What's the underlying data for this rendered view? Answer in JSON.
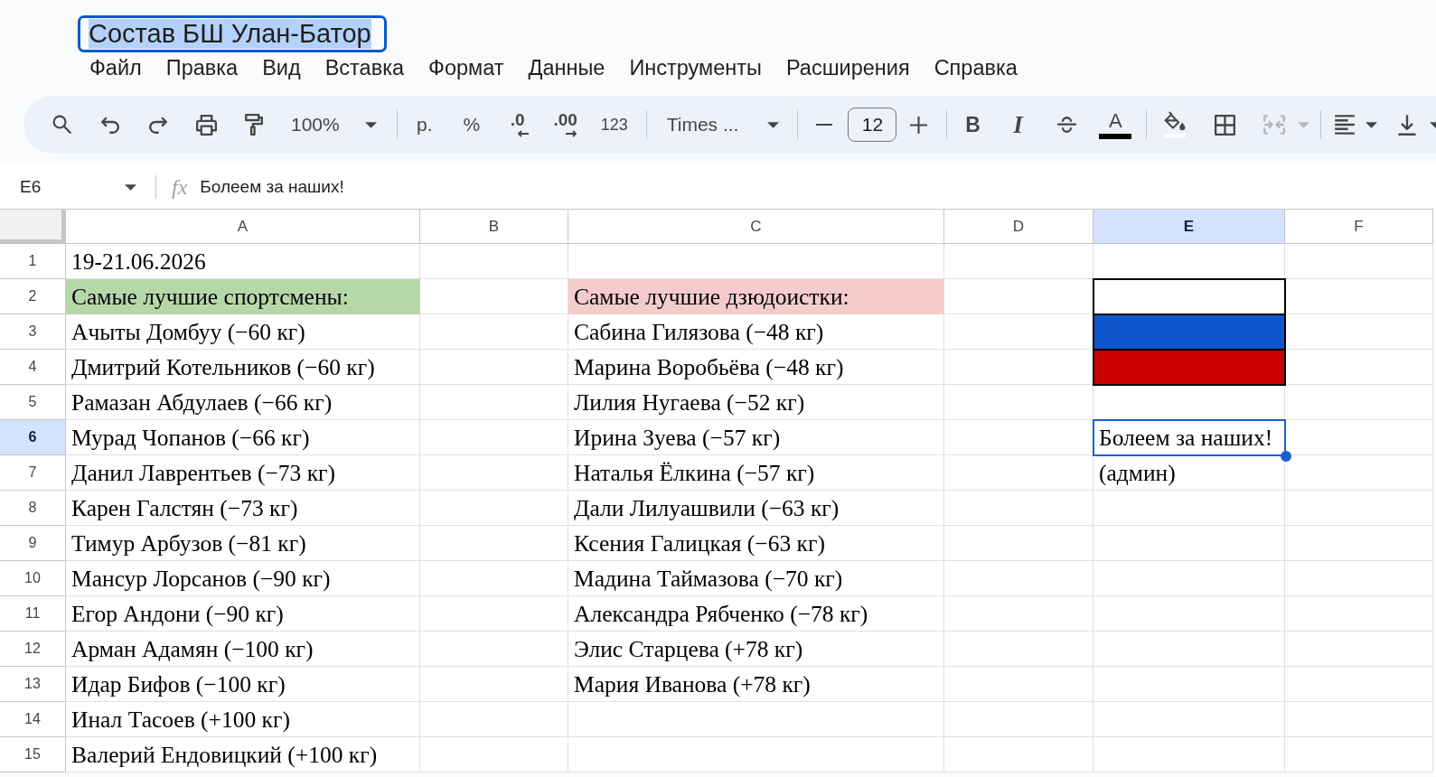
{
  "document": {
    "title": "Состав БШ Улан-Батор",
    "focused": true
  },
  "menu": [
    "Файл",
    "Правка",
    "Вид",
    "Вставка",
    "Формат",
    "Данные",
    "Инструменты",
    "Расширения",
    "Справка"
  ],
  "toolbar": {
    "zoom": "100%",
    "currency": "р.",
    "percent": "%",
    "decimal_decrease": ".0",
    "decimal_increase": ".00",
    "number_format": "123",
    "font": "Times ...",
    "font_size": "12",
    "bold": "B",
    "italic": "I",
    "text_color": "A",
    "merge_disabled": true
  },
  "formula_bar": {
    "cell_reference": "E6",
    "function_label": "fx",
    "value": "Болеем за наших!"
  },
  "grid": {
    "columns": [
      {
        "label": "A",
        "selected": false
      },
      {
        "label": "B",
        "selected": false
      },
      {
        "label": "C",
        "selected": false
      },
      {
        "label": "D",
        "selected": false
      },
      {
        "label": "E",
        "selected": true
      },
      {
        "label": "F",
        "selected": false
      }
    ],
    "rows": [
      {
        "label": "1",
        "selected": false,
        "a": {
          "text": "19-21.06.2026"
        }
      },
      {
        "label": "2",
        "selected": false,
        "a": {
          "text": "Самые лучшие спортсмены:",
          "color": "#b6d7a8",
          "bordered": false
        },
        "c": {
          "text": "Самые лучшие дзюдоистки:",
          "color": "#f4cccc",
          "bordered": false
        },
        "e": {
          "color": "#ffffff",
          "bordered": true
        }
      },
      {
        "label": "3",
        "selected": false,
        "a": {
          "text": "Ачыты Домбуу (−60 кг)"
        },
        "c": {
          "text": "Сабина Гилязова (−48 кг)"
        },
        "e": {
          "color": "#1155cc",
          "bordered": true
        }
      },
      {
        "label": "4",
        "selected": false,
        "a": {
          "text": "Дмитрий Котельников (−60 кг)"
        },
        "c": {
          "text": "Марина Воробьёва (−48 кг)"
        },
        "e": {
          "color": "#cc0000",
          "bordered": true
        }
      },
      {
        "label": "5",
        "selected": false,
        "a": {
          "text": "Рамазан Абдулаев (−66 кг)"
        },
        "c": {
          "text": "Лилия Нугаева (−52 кг)"
        }
      },
      {
        "label": "6",
        "selected": true,
        "a": {
          "text": "Мурад Чопанов (−66 кг)"
        },
        "c": {
          "text": "Ирина Зуева (−57 кг)"
        },
        "e": {
          "text": "Болеем за наших!"
        }
      },
      {
        "label": "7",
        "selected": false,
        "a": {
          "text": "Данил Лаврентьев (−73 кг)"
        },
        "c": {
          "text": "Наталья Ёлкина (−57 кг)"
        },
        "e": {
          "text": "(админ)"
        }
      },
      {
        "label": "8",
        "selected": false,
        "a": {
          "text": "Карен Галстян (−73 кг)"
        },
        "c": {
          "text": "Дали Лилуашвили (−63 кг)"
        }
      },
      {
        "label": "9",
        "selected": false,
        "a": {
          "text": "Тимур Арбузов (−81 кг)"
        },
        "c": {
          "text": "Ксения Галицкая (−63 кг)"
        }
      },
      {
        "label": "10",
        "selected": false,
        "a": {
          "text": "Мансур Лорсанов (−90 кг)"
        },
        "c": {
          "text": "Мадина Таймазова (−70 кг)"
        }
      },
      {
        "label": "11",
        "selected": false,
        "a": {
          "text": "Егор Андони (−90 кг)"
        },
        "c": {
          "text": "Александра Рябченко (−78 кг)"
        }
      },
      {
        "label": "12",
        "selected": false,
        "a": {
          "text": "Арман Адамян (−100 кг)"
        },
        "c": {
          "text": "Элис Старцева (+78 кг)"
        }
      },
      {
        "label": "13",
        "selected": false,
        "a": {
          "text": "Идар Бифов (−100 кг)"
        },
        "c": {
          "text": "Мария Иванова (+78 кг)"
        }
      },
      {
        "label": "14",
        "selected": false,
        "a": {
          "text": "Инал Тасоев (+100 кг)"
        }
      },
      {
        "label": "15",
        "selected": false,
        "a": {
          "text": "Валерий Ендовицкий (+100 кг)"
        }
      }
    ]
  }
}
